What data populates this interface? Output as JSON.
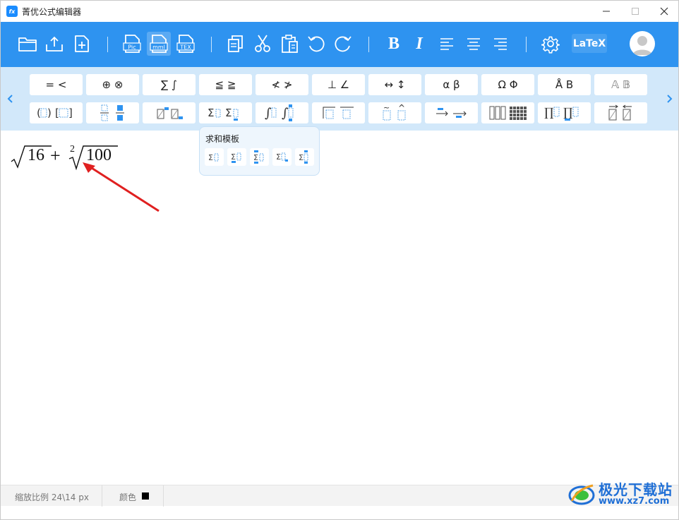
{
  "app": {
    "title": "菁优公式编辑器",
    "logo_text": "fx"
  },
  "window_controls": [
    "minimize",
    "maximize",
    "close"
  ],
  "toolbar": {
    "file_tags": {
      "pic": "Pic",
      "mml": "mml",
      "tex": "TEX"
    },
    "bold": "B",
    "italic": "I",
    "latex": "LaTeX"
  },
  "palette": {
    "row1": [
      "= <",
      "⊕ ⊗",
      "∑ ∫",
      "≦ ≧",
      "≮ ≯",
      "⊥ ∠",
      "↔ ↕",
      "α β",
      "Ω Φ",
      "Å B",
      "𝔸 𝔹"
    ],
    "row2": [
      "(⬚) [⬚]",
      "fractions",
      "scripts",
      "∑⬚ ∑⬚",
      "∫⬚ ∫⬚",
      "overbars",
      "accents",
      "arrows",
      "matrices",
      "∏⬚ ∏⬚",
      "vector arrows"
    ]
  },
  "popup": {
    "title": "求和模板",
    "items": [
      "∑⬚",
      "∑⬚",
      "∑⬚",
      "∑⬚",
      "∑⬚"
    ]
  },
  "formula": {
    "radicand1": "16",
    "operator": "+",
    "root_index": "2",
    "radicand2": "100"
  },
  "status": {
    "zoom": "缩放比例 24\\14 px",
    "color_label": "颜色",
    "color_value": "#000000"
  },
  "watermark": {
    "title": "极光下载站",
    "url": "www.xz7.com"
  },
  "colors": {
    "toolbar": "#2e93f0",
    "palette": "#d2e8fa",
    "annotation_arrow": "#e02020"
  }
}
